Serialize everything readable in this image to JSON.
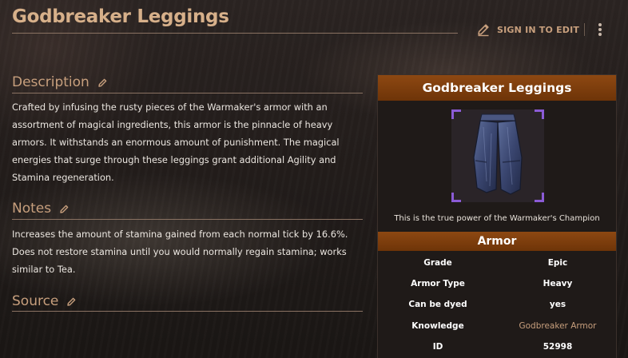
{
  "page": {
    "title": "Godbreaker Leggings",
    "sign_in_label": "SIGN IN TO EDIT"
  },
  "sections": {
    "description": {
      "heading": "Description",
      "text": "Crafted by infusing the rusty pieces of the Warmaker's armor with an assortment of magical ingredients, this armor is the pinnacle of heavy armors. It withstands an enormous amount of punishment. The magical energies that surge through these leggings grant additional Agility and Stamina regeneration."
    },
    "notes": {
      "heading": "Notes",
      "text": "Increases the amount of stamina gained from each normal tick by 16.6%. Does not restore stamina until you would normally regain stamina; works similar to Tea."
    },
    "source": {
      "heading": "Source"
    }
  },
  "infobox": {
    "title": "Godbreaker Leggings",
    "caption": "This is the true power of the Warmaker's Champion",
    "section_title": "Armor",
    "rows": [
      {
        "key": "Grade",
        "value": "Epic"
      },
      {
        "key": "Armor Type",
        "value": "Heavy"
      },
      {
        "key": "Can be dyed",
        "value": "yes"
      },
      {
        "key": "Knowledge",
        "value": "Godbreaker Armor"
      },
      {
        "key": "ID",
        "value": "52998"
      }
    ]
  },
  "icons": [
    "pencil-icon",
    "more-vertical-icon",
    "leggings-item-image"
  ],
  "colors": {
    "accent": "#c79f7d",
    "title": "#d7b08a",
    "infobox_header": "#8d4812",
    "rarity_frame": "#8b5bd6"
  }
}
